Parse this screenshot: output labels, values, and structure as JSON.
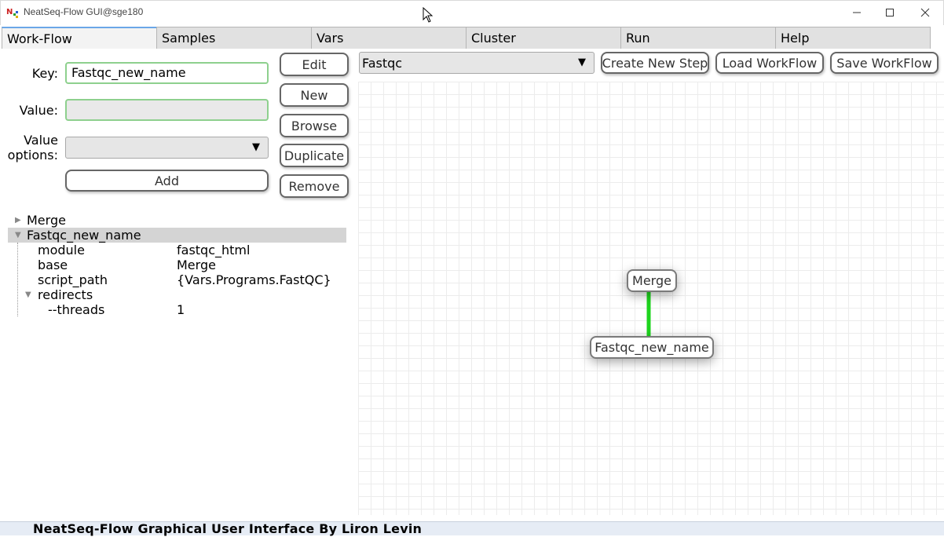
{
  "window": {
    "title": "NeatSeq-Flow GUI@sge180",
    "minimize_icon": "minimize-icon",
    "maximize_icon": "maximize-icon",
    "close_icon": "close-icon"
  },
  "tabs": [
    {
      "label": "Work-Flow",
      "active": true
    },
    {
      "label": "Samples"
    },
    {
      "label": "Vars"
    },
    {
      "label": "Cluster"
    },
    {
      "label": "Run"
    },
    {
      "label": "Help"
    }
  ],
  "form": {
    "key_label": "Key:",
    "key_value": "Fastqc_new_name",
    "value_label": "Value:",
    "value_value": "",
    "value_options_label_1": "Value",
    "value_options_label_2": "options:",
    "value_options_selected": "",
    "add_label": "Add"
  },
  "side_buttons": {
    "edit": "Edit",
    "new": "New",
    "browse": "Browse",
    "duplicate": "Duplicate",
    "remove": "Remove"
  },
  "tree": {
    "merge": "Merge",
    "fastqc": "Fastqc_new_name",
    "rows": [
      {
        "key": "module",
        "value": "fastqc_html"
      },
      {
        "key": "base",
        "value": "Merge"
      },
      {
        "key": "script_path",
        "value": "{Vars.Programs.FastQC}"
      }
    ],
    "redirects": "redirects",
    "threads_key": "--threads",
    "threads_value": "1"
  },
  "toolbar": {
    "module_selected": "Fastqc",
    "create_step": "Create New Step",
    "load_workflow": "Load WorkFlow",
    "save_workflow": "Save WorkFlow"
  },
  "graph": {
    "nodes": [
      "Merge",
      "Fastqc_new_name"
    ],
    "edge_color": "#1ed41e"
  },
  "status": "NeatSeq-Flow Graphical User Interface By Liron Levin"
}
